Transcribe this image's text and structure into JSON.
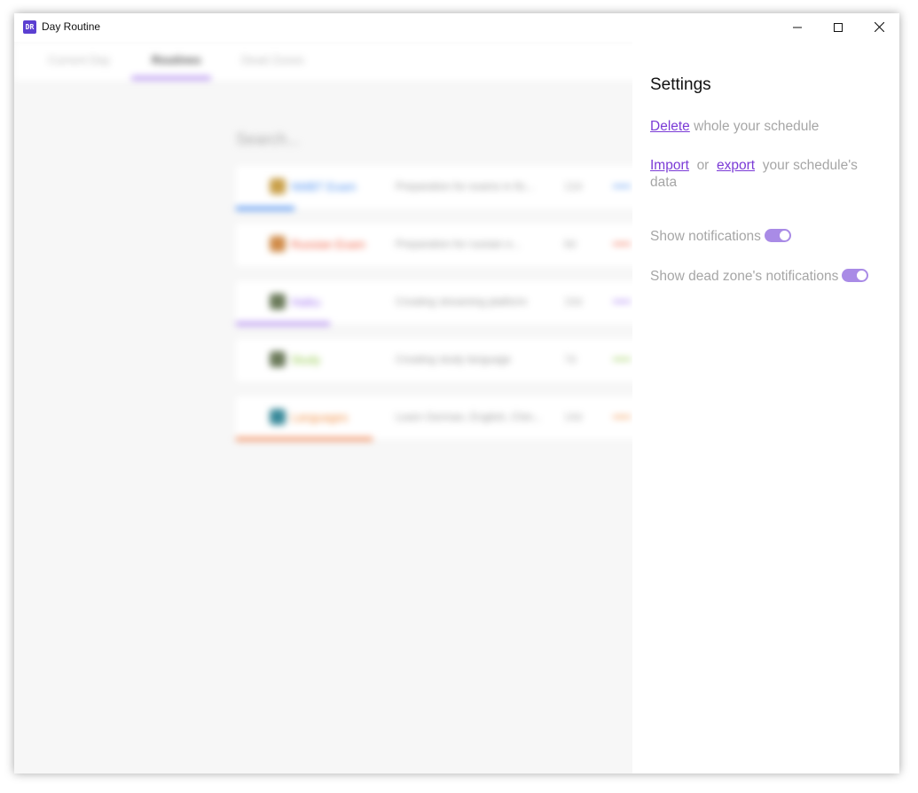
{
  "window": {
    "title": "Day Routine",
    "icon_text": "DR"
  },
  "tabs": [
    {
      "label": "Current Day"
    },
    {
      "label": "Routines"
    },
    {
      "label": "Dead Zones"
    }
  ],
  "search": {
    "placeholder": "Search..."
  },
  "routines": [
    {
      "name": "NMBT Exam",
      "description": "Preparation for exams in fiz...",
      "count": "12d",
      "color": "#4a8ef0"
    },
    {
      "name": "Russian Exam",
      "description": "Preparation for russian e...",
      "count": "8d",
      "color": "#f05a3c"
    },
    {
      "name": "Haiku",
      "description": "Creating streaming platform",
      "count": "10d",
      "color": "#9b6cf0"
    },
    {
      "name": "Study",
      "description": "Creating study language",
      "count": "7d",
      "color": "#8cc63f"
    },
    {
      "name": "Languages",
      "description": "Learn German, English, Chin...",
      "count": "14d",
      "color": "#f08a3c"
    }
  ],
  "settings": {
    "title": "Settings",
    "delete_link": "Delete",
    "delete_text": " whole your schedule",
    "import_link": "Import",
    "or_text": "or",
    "export_link": "export",
    "data_text": "your schedule's data",
    "notifications_label": "Show notifications",
    "notifications_on": true,
    "dead_zone_label": "Show dead zone's notifications",
    "dead_zone_on": true
  },
  "colors": {
    "accent": "#7b3bd6",
    "toggle": "#a98be6"
  }
}
